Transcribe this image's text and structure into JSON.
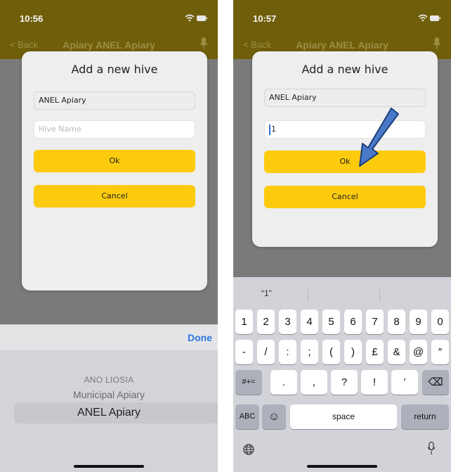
{
  "left_screen": {
    "status_bar": {
      "time": "10:56"
    },
    "nav": {
      "back": "Back",
      "title": "Apiary ANEL Apiary"
    },
    "modal": {
      "title": "Add a new hive",
      "apiary_value": "ANEL Apiary",
      "hive_name_placeholder": "Hive Name",
      "ok_label": "Ok",
      "cancel_label": "Cancel"
    },
    "picker_toolbar": {
      "done_label": "Done"
    },
    "picker": {
      "options": [
        "ANO LIOSIA",
        "Municipal Apiary",
        "ANEL Apiary"
      ],
      "selected": "ANEL Apiary"
    }
  },
  "right_screen": {
    "status_bar": {
      "time": "10:57"
    },
    "nav": {
      "back": "Back",
      "title": "Apiary ANEL Apiary"
    },
    "modal": {
      "title": "Add a new hive",
      "apiary_value": "ANEL Apiary",
      "hive_name_value": "1",
      "ok_label": "Ok",
      "cancel_label": "Cancel"
    },
    "keyboard": {
      "suggestion": "“1”",
      "row1": [
        "1",
        "2",
        "3",
        "4",
        "5",
        "6",
        "7",
        "8",
        "9",
        "0"
      ],
      "row2": [
        "-",
        "/",
        ":",
        ";",
        "(",
        ")",
        "£",
        "&",
        "@",
        "″"
      ],
      "row3_left": "#+=",
      "row3": [
        ".",
        ",",
        "?",
        "!",
        "’"
      ],
      "row3_right": "⌫",
      "abc": "ABC",
      "emoji": "☺",
      "space": "space",
      "return": "return"
    }
  },
  "colors": {
    "accent_yellow": "#fccb0e",
    "nav_olive": "#6f5f0a",
    "link_blue": "#2c78e0",
    "arrow_blue": "#4a78c8"
  }
}
